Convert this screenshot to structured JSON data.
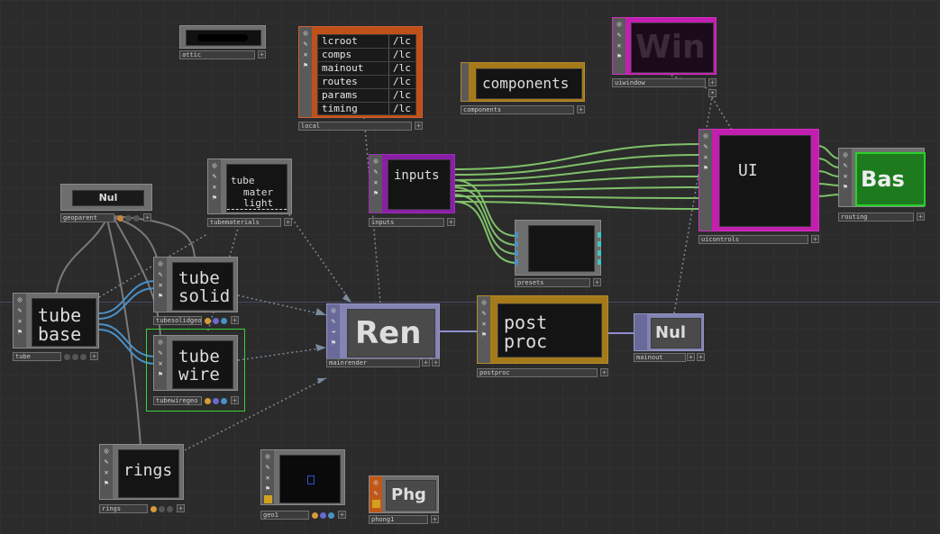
{
  "nodes": {
    "attic": {
      "name": "attic"
    },
    "local": {
      "name": "local",
      "rows": [
        {
          "key": "lcroot",
          "val": "/lc"
        },
        {
          "key": "comps",
          "val": "/lc"
        },
        {
          "key": "mainout",
          "val": "/lc"
        },
        {
          "key": "routes",
          "val": "/lc"
        },
        {
          "key": "params",
          "val": "/lc"
        },
        {
          "key": "timing",
          "val": "/lc"
        }
      ]
    },
    "components": {
      "name": "components",
      "label": "components"
    },
    "uiwindow": {
      "name": "uiwindow",
      "label": "Win"
    },
    "geoparent": {
      "name": "geoparent",
      "label": "Nul"
    },
    "tubematerials": {
      "name": "tubematerials",
      "label_lines": [
        "tube",
        "mater",
        "light"
      ]
    },
    "inputs": {
      "name": "inputs",
      "label": "inputs"
    },
    "presets": {
      "name": "presets"
    },
    "uicontrols": {
      "name": "uicontrols",
      "label": "UI"
    },
    "routing": {
      "name": "routing",
      "label": "Bas"
    },
    "tube": {
      "name": "tube",
      "label_lines": [
        "tube",
        "base"
      ]
    },
    "tubesolidgeo": {
      "name": "tubesolidgeo",
      "label_lines": [
        "tube",
        "solid"
      ]
    },
    "tubewiregeo": {
      "name": "tubewiregeo",
      "label_lines": [
        "tube",
        "wire"
      ]
    },
    "mainrender": {
      "name": "mainrender",
      "label": "Ren"
    },
    "postproc": {
      "name": "postproc",
      "label_lines": [
        "post",
        "proc"
      ]
    },
    "mainout": {
      "name": "mainout",
      "label": "Nul"
    },
    "rings": {
      "name": "rings",
      "label": "rings"
    },
    "geo1": {
      "name": "geo1"
    },
    "phong1": {
      "name": "phong1",
      "label": "Phg"
    }
  },
  "colors": {
    "background": "#2b2b2b",
    "comp_orange": "#c0501a",
    "comp_purple": "#8a1fa6",
    "comp_magenta": "#c21fb0",
    "comp_yellow": "#a57a1a",
    "dat_green": "#2aa42a",
    "chop_wire": "#7fc06a",
    "sop_wire": "#4a90c8",
    "top_wire": "#8f8fd0",
    "selected": "#3bd23b"
  },
  "icons": [
    "circle-target-icon",
    "pencil-icon",
    "x-icon",
    "arrow-icon",
    "flag-icon",
    "bug-icon",
    "plus-icon"
  ]
}
